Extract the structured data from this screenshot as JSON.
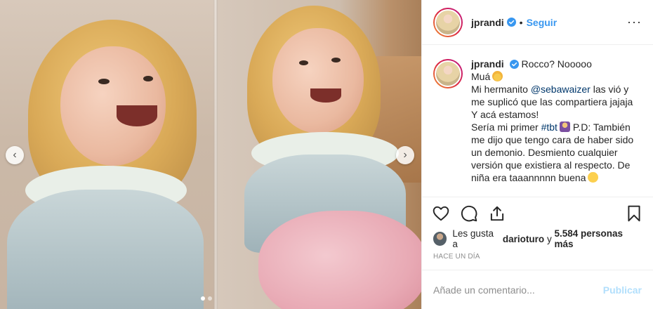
{
  "post": {
    "username": "jprandi",
    "separator": "•",
    "follow_label": "Seguir",
    "more_label": "···"
  },
  "caption": {
    "username": "jprandi",
    "line1": "Rocco? Nooooo",
    "line2": "Muá",
    "line3_pre": "Mi hermanito ",
    "mention": "@sebawaizer",
    "line3_post": " las vió y me suplicó que las compartiera jajaja",
    "line4": "Y acá estamos!",
    "line5_pre": "Sería mi primer ",
    "hashtag": "#tbt",
    "line5_post": " P.D: También me dijo que tengo cara de haber sido un demonio. Desmiento cualquier versión que existiera al respecto. De niña era taaannnnn buena",
    "emojis": [
      "blond-girl-emoji",
      "person-emoji",
      "smiling-face-emoji"
    ]
  },
  "likes": {
    "prefix": "Les gusta a ",
    "user": "darioturo",
    "middle": " y ",
    "count": "5.584 personas más"
  },
  "timestamp": "HACE UN DÍA",
  "comment": {
    "placeholder": "Añade un comentario...",
    "publish_label": "Publicar"
  },
  "carousel": {
    "total": 2,
    "active": 1,
    "prev_label": "‹",
    "next_label": "›"
  },
  "colors": {
    "link": "#00376b",
    "follow": "#3897f0",
    "publish_disabled": "#b2dffc",
    "verified": "#3897f0"
  }
}
